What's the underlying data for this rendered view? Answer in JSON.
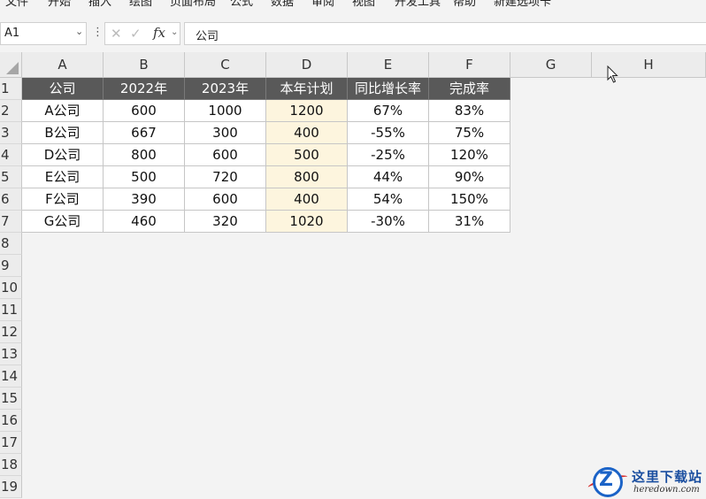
{
  "ribbon": {
    "tabs": [
      "文件",
      "开始",
      "插入",
      "绘图",
      "页面布局",
      "公式",
      "数据",
      "审阅",
      "视图",
      "开发工具",
      "帮助",
      "新建选项卡"
    ]
  },
  "formula_bar": {
    "name_box": "A1",
    "formula": "公司",
    "fx_label": "fx"
  },
  "columns": [
    "A",
    "B",
    "C",
    "D",
    "E",
    "F",
    "G",
    "H"
  ],
  "rows": [
    "1",
    "2",
    "3",
    "4",
    "5",
    "6",
    "7",
    "8",
    "9",
    "10",
    "11",
    "12",
    "13",
    "14",
    "15",
    "16",
    "17",
    "18",
    "19"
  ],
  "table": {
    "header": [
      "公司",
      "2022年",
      "2023年",
      "本年计划",
      "同比增长率",
      "完成率"
    ],
    "body": [
      [
        "A公司",
        "600",
        "1000",
        "1200",
        "67%",
        "83%"
      ],
      [
        "B公司",
        "667",
        "300",
        "400",
        "-55%",
        "75%"
      ],
      [
        "D公司",
        "800",
        "600",
        "500",
        "-25%",
        "120%"
      ],
      [
        "E公司",
        "500",
        "720",
        "800",
        "44%",
        "90%"
      ],
      [
        "F公司",
        "390",
        "600",
        "400",
        "54%",
        "150%"
      ],
      [
        "G公司",
        "460",
        "320",
        "1020",
        "-30%",
        "31%"
      ]
    ]
  },
  "colors": {
    "header_fill": "#595959",
    "plan_fill": "#fdf5de"
  },
  "watermark": {
    "title": "这里下载站",
    "url": "heredown.com"
  }
}
